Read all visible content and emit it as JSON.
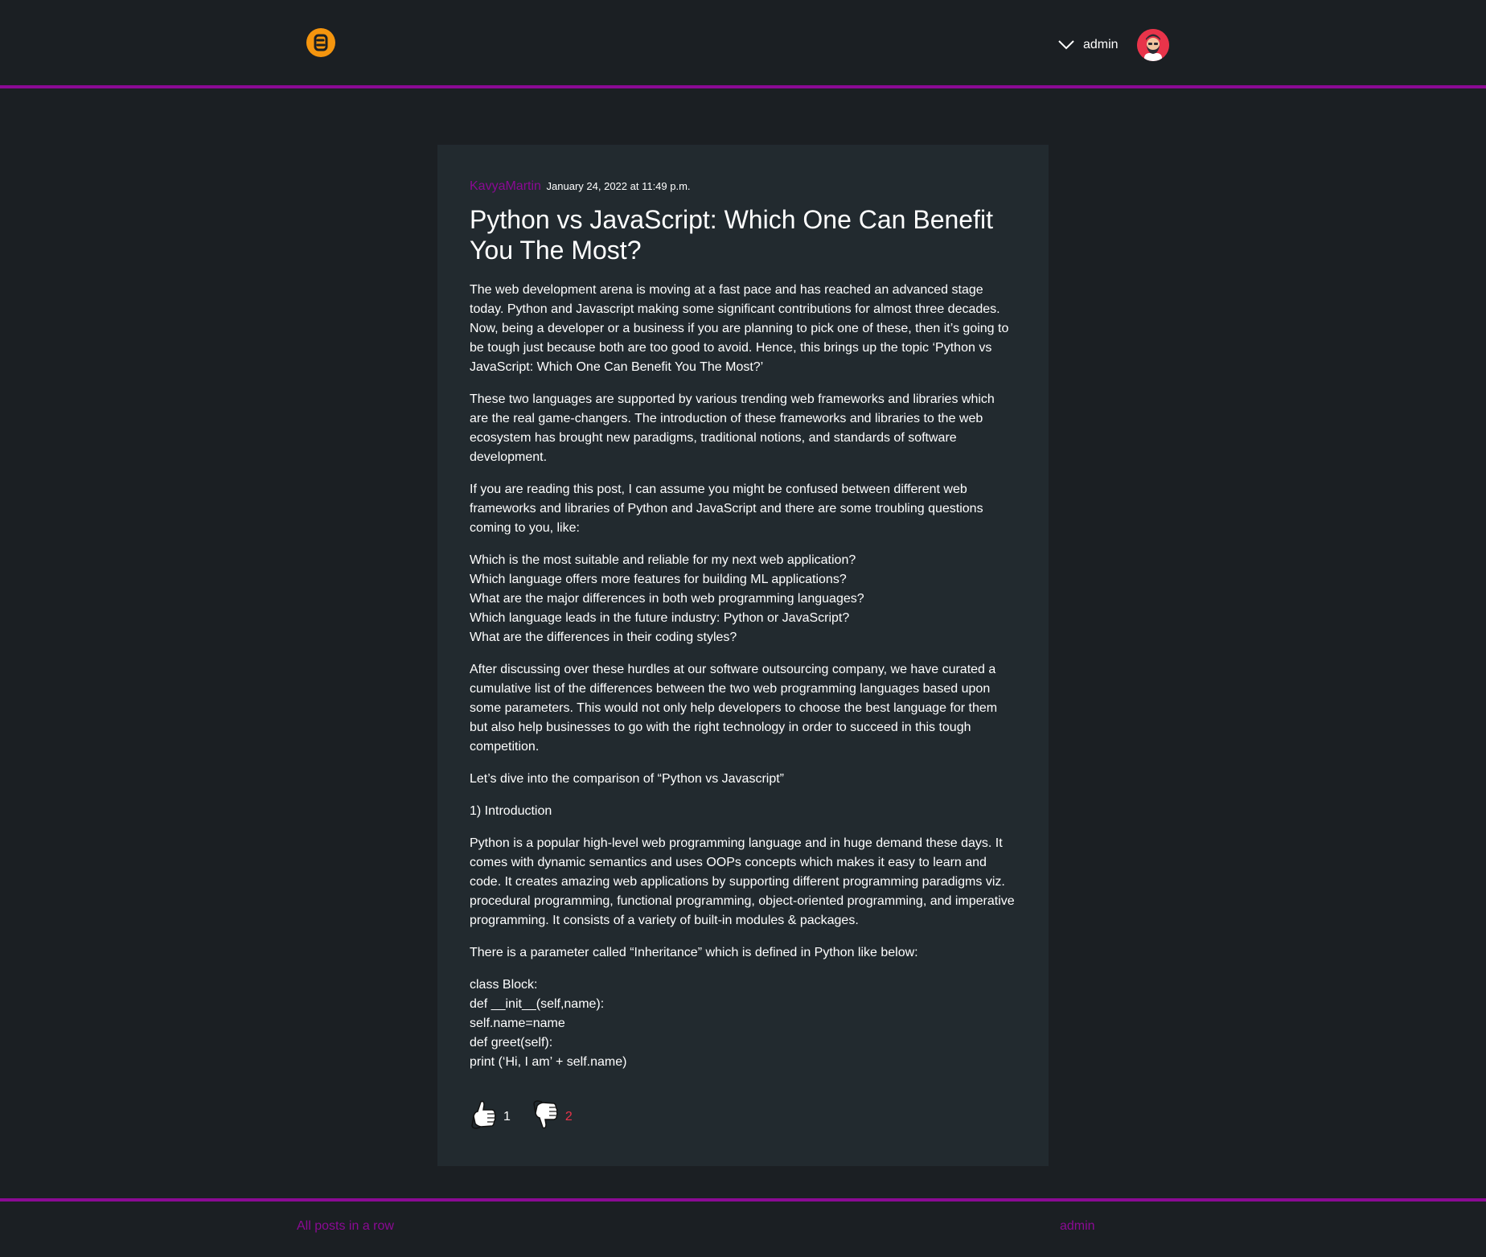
{
  "header": {
    "logo_icon": "blogger-logo-icon",
    "menu_icon": "chevron-down-icon",
    "username": "admin",
    "avatar_icon": "avatar-icon"
  },
  "post": {
    "author": "KavyaMartin",
    "date": "January 24, 2022 at 11:49 p.m.",
    "title": "Python vs JavaScript: Which One Can Benefit You The Most?",
    "paragraphs": [
      "The web development arena is moving at a fast pace and has reached an advanced stage today. Python and Javascript making some significant contributions for almost three decades. Now, being a developer or a business if you are planning to pick one of these, then it’s going to be tough just because both are too good to avoid. Hence, this brings up the topic ‘Python vs JavaScript: Which One Can Benefit You The Most?’",
      "These two languages are supported by various trending web frameworks and libraries which are the real game-changers. The introduction of these frameworks and libraries to the web ecosystem has brought new paradigms, traditional notions, and standards of software development.",
      "If you are reading this post, I can assume you might be confused between different web frameworks and libraries of Python and JavaScript and there are some troubling questions coming to you, like:"
    ],
    "questions": [
      "Which is the most suitable and reliable for my next web application?",
      "Which language offers more features for building ML applications?",
      "What are the major differences in both web programming languages?",
      "Which language leads in the future industry: Python or JavaScript?",
      "What are the differences in their coding styles?"
    ],
    "paragraphs2": [
      "After discussing over these hurdles at our software outsourcing company, we have curated a cumulative list of the differences between the two web programming languages based upon some parameters. This would not only help developers to choose the best language for them but also help businesses to go with the right technology in order to succeed in this tough competition.",
      "Let’s dive into the comparison of “Python vs Javascript”",
      "1) Introduction",
      "Python is a popular high-level web programming language and in huge demand these days. It comes with dynamic semantics and uses OOPs concepts which makes it easy to learn and code. It creates amazing web applications by supporting different programming paradigms viz. procedural programming, functional programming, object-oriented programming, and imperative programming. It consists of a variety of built-in modules & packages.",
      "There is a parameter called “Inheritance” which is defined in Python like below:"
    ],
    "code_lines": [
      "class Block:",
      "def __init__(self,name):",
      "self.name=name",
      "def greet(self):",
      "print (‘Hi, I am’ + self.name)"
    ],
    "likes": "1",
    "dislikes": "2",
    "like_icon": "thumbs-up-icon",
    "dislike_icon": "thumbs-down-icon"
  },
  "footer": {
    "left_link": "All posts in a row",
    "right_link": "admin"
  },
  "colors": {
    "accent": "#8b0a94",
    "logo": "#f5950e",
    "dislike": "#e8344a",
    "background": "#1b1f23",
    "card": "#222a2f"
  }
}
